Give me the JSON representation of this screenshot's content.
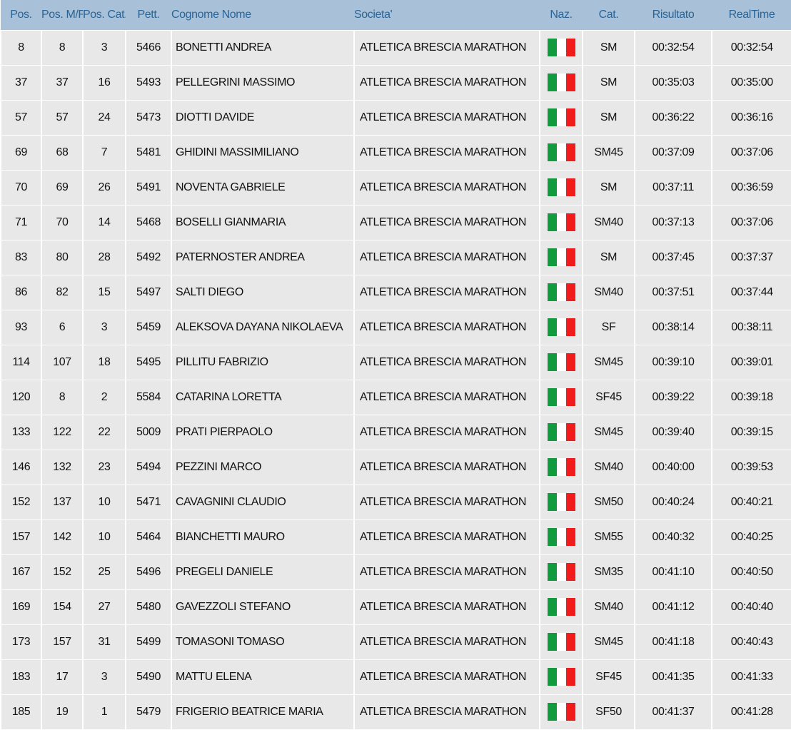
{
  "headers": [
    "Pos.",
    "Pos. M/F",
    "Pos. Cat.",
    "Pett.",
    "Cognome Nome",
    "Societa'",
    "Naz.",
    "Cat.",
    "Risultato",
    "RealTime"
  ],
  "flag_colors": {
    "green": "#119a3e",
    "white": "#ffffff",
    "red": "#f11b1b"
  },
  "rows": [
    {
      "pos": "8",
      "pos_mf": "8",
      "pos_cat": "3",
      "pett": "5466",
      "name": "BONETTI ANDREA",
      "club": "ATLETICA BRESCIA MARATHON",
      "naz": "italy-flag",
      "cat": "SM",
      "risultato": "00:32:54",
      "realtime": "00:32:54"
    },
    {
      "pos": "37",
      "pos_mf": "37",
      "pos_cat": "16",
      "pett": "5493",
      "name": "PELLEGRINI MASSIMO",
      "club": "ATLETICA BRESCIA MARATHON",
      "naz": "italy-flag",
      "cat": "SM",
      "risultato": "00:35:03",
      "realtime": "00:35:00"
    },
    {
      "pos": "57",
      "pos_mf": "57",
      "pos_cat": "24",
      "pett": "5473",
      "name": "DIOTTI DAVIDE",
      "club": "ATLETICA BRESCIA MARATHON",
      "naz": "italy-flag",
      "cat": "SM",
      "risultato": "00:36:22",
      "realtime": "00:36:16"
    },
    {
      "pos": "69",
      "pos_mf": "68",
      "pos_cat": "7",
      "pett": "5481",
      "name": "GHIDINI MASSIMILIANO",
      "club": "ATLETICA BRESCIA MARATHON",
      "naz": "italy-flag",
      "cat": "SM45",
      "risultato": "00:37:09",
      "realtime": "00:37:06"
    },
    {
      "pos": "70",
      "pos_mf": "69",
      "pos_cat": "26",
      "pett": "5491",
      "name": "NOVENTA GABRIELE",
      "club": "ATLETICA BRESCIA MARATHON",
      "naz": "italy-flag",
      "cat": "SM",
      "risultato": "00:37:11",
      "realtime": "00:36:59"
    },
    {
      "pos": "71",
      "pos_mf": "70",
      "pos_cat": "14",
      "pett": "5468",
      "name": "BOSELLI GIANMARIA",
      "club": "ATLETICA BRESCIA MARATHON",
      "naz": "italy-flag",
      "cat": "SM40",
      "risultato": "00:37:13",
      "realtime": "00:37:06"
    },
    {
      "pos": "83",
      "pos_mf": "80",
      "pos_cat": "28",
      "pett": "5492",
      "name": "PATERNOSTER ANDREA",
      "club": "ATLETICA BRESCIA MARATHON",
      "naz": "italy-flag",
      "cat": "SM",
      "risultato": "00:37:45",
      "realtime": "00:37:37"
    },
    {
      "pos": "86",
      "pos_mf": "82",
      "pos_cat": "15",
      "pett": "5497",
      "name": "SALTI DIEGO",
      "club": "ATLETICA BRESCIA MARATHON",
      "naz": "italy-flag",
      "cat": "SM40",
      "risultato": "00:37:51",
      "realtime": "00:37:44"
    },
    {
      "pos": "93",
      "pos_mf": "6",
      "pos_cat": "3",
      "pett": "5459",
      "name": "ALEKSOVA DAYANA NIKOLAEVA",
      "club": "ATLETICA BRESCIA MARATHON",
      "naz": "italy-flag",
      "cat": "SF",
      "risultato": "00:38:14",
      "realtime": "00:38:11"
    },
    {
      "pos": "114",
      "pos_mf": "107",
      "pos_cat": "18",
      "pett": "5495",
      "name": "PILLITU FABRIZIO",
      "club": "ATLETICA BRESCIA MARATHON",
      "naz": "italy-flag",
      "cat": "SM45",
      "risultato": "00:39:10",
      "realtime": "00:39:01"
    },
    {
      "pos": "120",
      "pos_mf": "8",
      "pos_cat": "2",
      "pett": "5584",
      "name": "CATARINA LORETTA",
      "club": "ATLETICA BRESCIA MARATHON",
      "naz": "italy-flag",
      "cat": "SF45",
      "risultato": "00:39:22",
      "realtime": "00:39:18"
    },
    {
      "pos": "133",
      "pos_mf": "122",
      "pos_cat": "22",
      "pett": "5009",
      "name": "PRATI PIERPAOLO",
      "club": "ATLETICA BRESCIA MARATHON",
      "naz": "italy-flag",
      "cat": "SM45",
      "risultato": "00:39:40",
      "realtime": "00:39:15"
    },
    {
      "pos": "146",
      "pos_mf": "132",
      "pos_cat": "23",
      "pett": "5494",
      "name": "PEZZINI MARCO",
      "club": "ATLETICA BRESCIA MARATHON",
      "naz": "italy-flag",
      "cat": "SM40",
      "risultato": "00:40:00",
      "realtime": "00:39:53"
    },
    {
      "pos": "152",
      "pos_mf": "137",
      "pos_cat": "10",
      "pett": "5471",
      "name": "CAVAGNINI CLAUDIO",
      "club": "ATLETICA BRESCIA MARATHON",
      "naz": "italy-flag",
      "cat": "SM50",
      "risultato": "00:40:24",
      "realtime": "00:40:21"
    },
    {
      "pos": "157",
      "pos_mf": "142",
      "pos_cat": "10",
      "pett": "5464",
      "name": "BIANCHETTI MAURO",
      "club": "ATLETICA BRESCIA MARATHON",
      "naz": "italy-flag",
      "cat": "SM55",
      "risultato": "00:40:32",
      "realtime": "00:40:25"
    },
    {
      "pos": "167",
      "pos_mf": "152",
      "pos_cat": "25",
      "pett": "5496",
      "name": "PREGELI DANIELE",
      "club": "ATLETICA BRESCIA MARATHON",
      "naz": "italy-flag",
      "cat": "SM35",
      "risultato": "00:41:10",
      "realtime": "00:40:50"
    },
    {
      "pos": "169",
      "pos_mf": "154",
      "pos_cat": "27",
      "pett": "5480",
      "name": "GAVEZZOLI STEFANO",
      "club": "ATLETICA BRESCIA MARATHON",
      "naz": "italy-flag",
      "cat": "SM40",
      "risultato": "00:41:12",
      "realtime": "00:40:40"
    },
    {
      "pos": "173",
      "pos_mf": "157",
      "pos_cat": "31",
      "pett": "5499",
      "name": "TOMASONI TOMASO",
      "club": "ATLETICA BRESCIA MARATHON",
      "naz": "italy-flag",
      "cat": "SM45",
      "risultato": "00:41:18",
      "realtime": "00:40:43"
    },
    {
      "pos": "183",
      "pos_mf": "17",
      "pos_cat": "3",
      "pett": "5490",
      "name": "MATTU ELENA",
      "club": "ATLETICA BRESCIA MARATHON",
      "naz": "italy-flag",
      "cat": "SF45",
      "risultato": "00:41:35",
      "realtime": "00:41:33"
    },
    {
      "pos": "185",
      "pos_mf": "19",
      "pos_cat": "1",
      "pett": "5479",
      "name": "FRIGERIO BEATRICE MARIA",
      "club": "ATLETICA BRESCIA MARATHON",
      "naz": "italy-flag",
      "cat": "SF50",
      "risultato": "00:41:37",
      "realtime": "00:41:28"
    }
  ]
}
